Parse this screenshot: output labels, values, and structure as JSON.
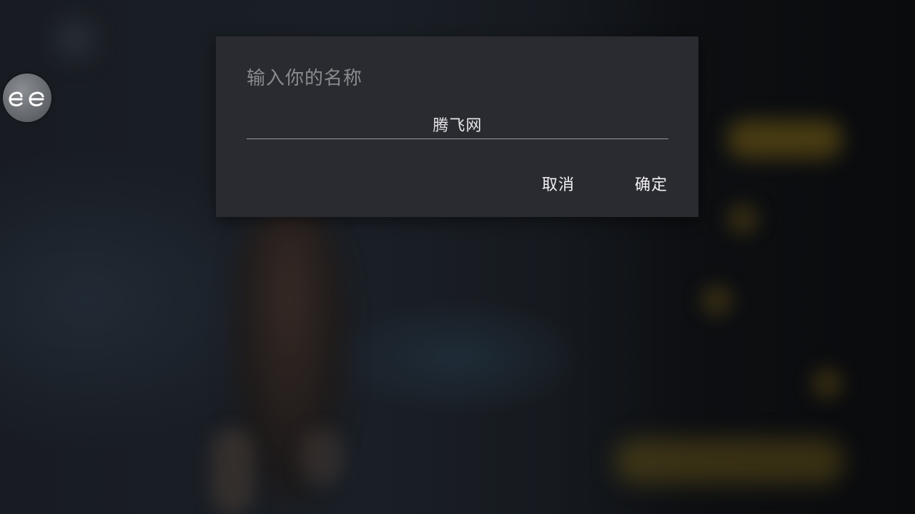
{
  "dialog": {
    "title": "输入你的名称",
    "name_value": "腾飞网",
    "cancel_label": "取消",
    "confirm_label": "确定"
  },
  "colors": {
    "dialog_bg": "#2a2b30",
    "title_text": "#8a8b8f",
    "button_text": "#f2f2f4",
    "underline": "#9a9ba0"
  },
  "icons": {
    "app_logo": "app-logo-icon"
  }
}
